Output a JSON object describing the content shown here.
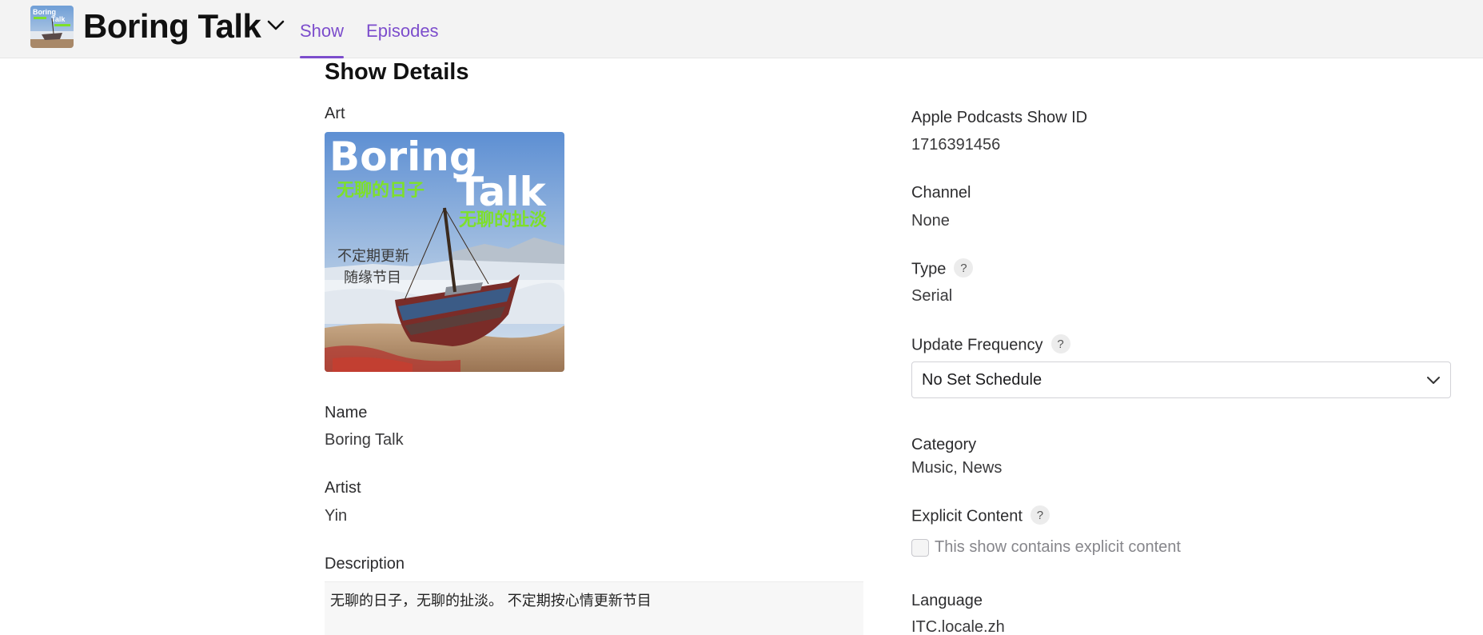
{
  "header": {
    "show_title": "Boring Talk",
    "tabs": [
      {
        "label": "Show",
        "active": true
      },
      {
        "label": "Episodes",
        "active": false
      }
    ]
  },
  "thumbnail": {
    "title_line1": "Boring",
    "title_line2": "Talk"
  },
  "details": {
    "section_title": "Show Details",
    "art_label": "Art",
    "art": {
      "title_word1": "Boring",
      "title_word2": "Talk",
      "subtitle1": "无聊的日子",
      "subtitle2": "无聊的扯淡",
      "note_line1": "不定期更新",
      "note_line2": "随缘节目"
    },
    "name_label": "Name",
    "name_value": "Boring Talk",
    "artist_label": "Artist",
    "artist_value": "Yin",
    "description_label": "Description",
    "description_value": "无聊的日子，无聊的扯淡。 不定期按心情更新节目",
    "apple_id_label": "Apple Podcasts Show ID",
    "apple_id_value": "1716391456",
    "channel_label": "Channel",
    "channel_value": "None",
    "type_label": "Type",
    "type_value": "Serial",
    "update_frequency_label": "Update Frequency",
    "update_frequency_value": "No Set Schedule",
    "category_label": "Category",
    "category_value": "Music, News",
    "explicit_label": "Explicit Content",
    "explicit_checkbox_label": "This show contains explicit content",
    "explicit_checked": false,
    "language_label": "Language",
    "language_value": "ITC.locale.zh",
    "help_glyph": "?"
  },
  "colors": {
    "accent": "#7c4dcc",
    "header_bg": "#f3f3f3",
    "art_green": "#7ee02a"
  }
}
